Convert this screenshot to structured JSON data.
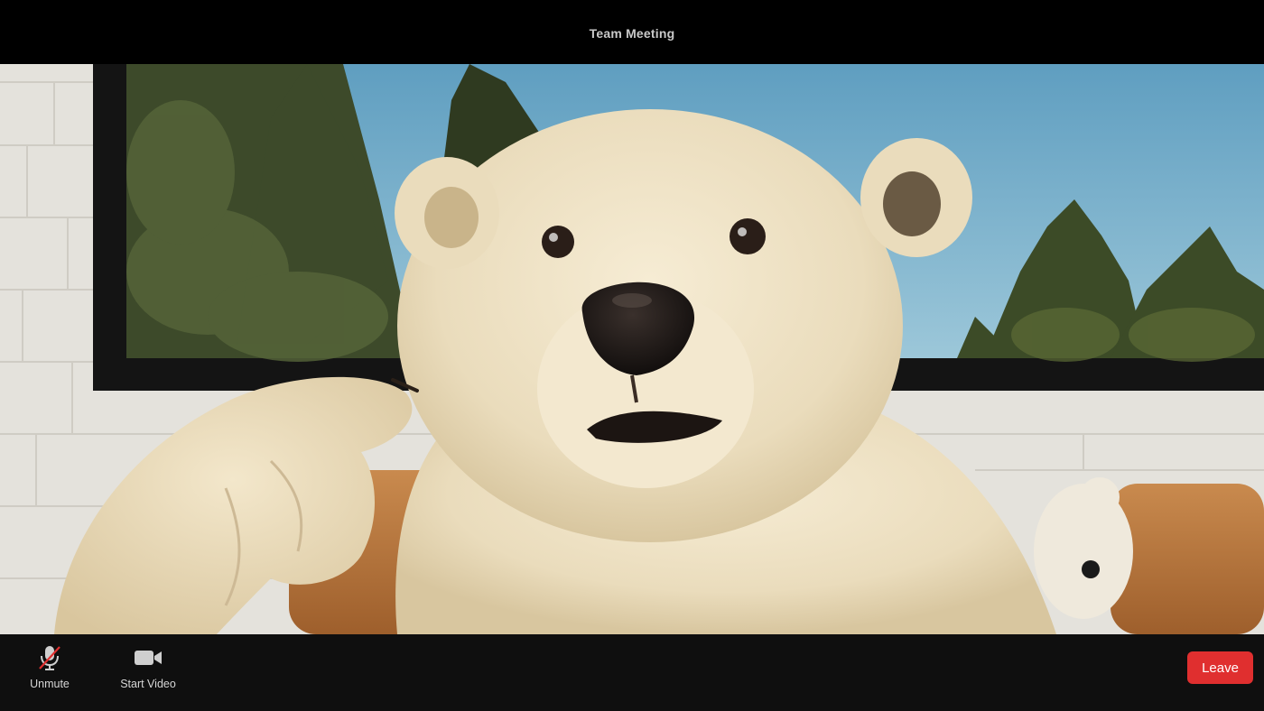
{
  "window": {
    "title": "Team Meeting"
  },
  "toolbar": {
    "unmute_label": "Unmute",
    "start_video_label": "Start Video",
    "leave_label": "Leave",
    "mic_icon": "mic-muted-icon",
    "video_icon": "video-camera-icon"
  },
  "colors": {
    "leave": "#e02f2f",
    "toolbar_bg": "#0f0f0f",
    "mute_slash": "#e02f2f"
  }
}
